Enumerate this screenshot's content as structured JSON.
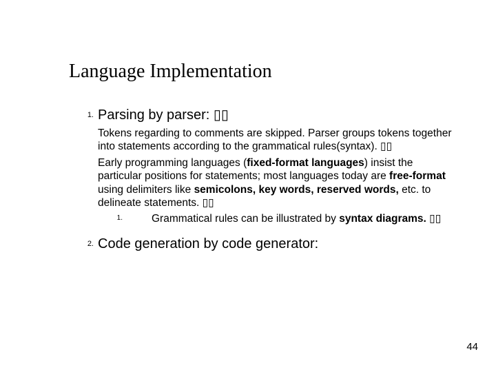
{
  "title": "Language Implementation",
  "items": {
    "i1": {
      "num": "1.",
      "heading": "Parsing by parser: ▯▯",
      "para1_pre": "Tokens regarding to comments are skipped. Parser groups tokens together into statements according to the grammatical rules(syntax). ▯▯",
      "para2_a": "Early programming languages (",
      "para2_b": "fixed-format languages",
      "para2_c": ") insist the particular positions for statements; most languages today are ",
      "para2_d": "free-format",
      "para2_e": " using delimiters like ",
      "para2_f": "semicolons, key words, reserved words,",
      "para2_g": " etc. to delineate statements. ▯▯",
      "sub": {
        "num": "1.",
        "text_a": "Grammatical rules can be illustrated by ",
        "text_b": "syntax diagrams.",
        "text_c": " ▯▯"
      }
    },
    "i2": {
      "num": "2.",
      "heading": "Code generation by code generator:"
    }
  },
  "slide_number": "44"
}
